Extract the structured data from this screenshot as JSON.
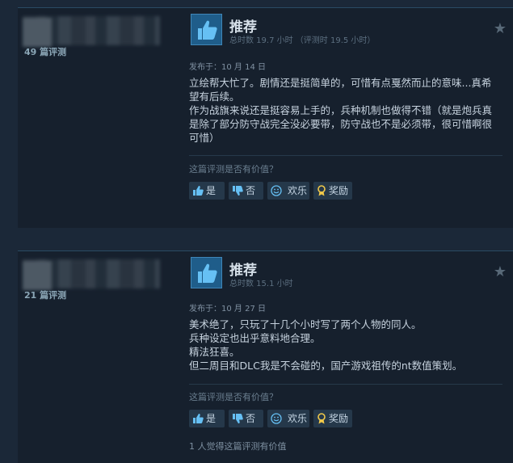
{
  "reviews": [
    {
      "review_count": "49 篇评测",
      "verdict": "推荐",
      "hours": "总时数 19.7 小时 （评测时 19.5 小时）",
      "posted": "发布于：10 月 14 日",
      "lines": [
        "立绘帮大忙了。剧情还是挺简单的，可惜有点戛然而止的意味...真希",
        "望有后续。",
        "作为战旗来说还是挺容易上手的，兵种机制也做得不错（就是炮兵真",
        "是除了部分防守战完全没必要带，防守战也不是必须带，很可惜啊很",
        "可惜）"
      ],
      "helpful_question": "这篇评测是否有价值？",
      "buttons": {
        "yes": "是",
        "no": "否",
        "funny": "欢乐",
        "award": "奖励"
      },
      "found_helpful": ""
    },
    {
      "review_count": "21 篇评测",
      "verdict": "推荐",
      "hours": "总时数 15.1 小时",
      "posted": "发布于：10 月 27 日",
      "lines": [
        "美术绝了，只玩了十几个小时写了两个人物的同人。",
        "兵种设定也出乎意料地合理。",
        "精法狂喜。",
        "但二周目和DLC我是不会碰的，国产游戏祖传的nt数值策划。"
      ],
      "helpful_question": "这篇评测是否有价值？",
      "buttons": {
        "yes": "是",
        "no": "否",
        "funny": "欢乐",
        "award": "奖励"
      },
      "found_helpful": "1 人觉得这篇评测有价值"
    }
  ],
  "colors": {
    "accent": "#1f5d8a",
    "text": "#c6d2de",
    "bg": "#1b2838",
    "card": "#16202d"
  },
  "icons": [
    "thumbs-up-icon",
    "thumbs-down-icon",
    "smiley-icon",
    "award-icon",
    "star-icon"
  ]
}
